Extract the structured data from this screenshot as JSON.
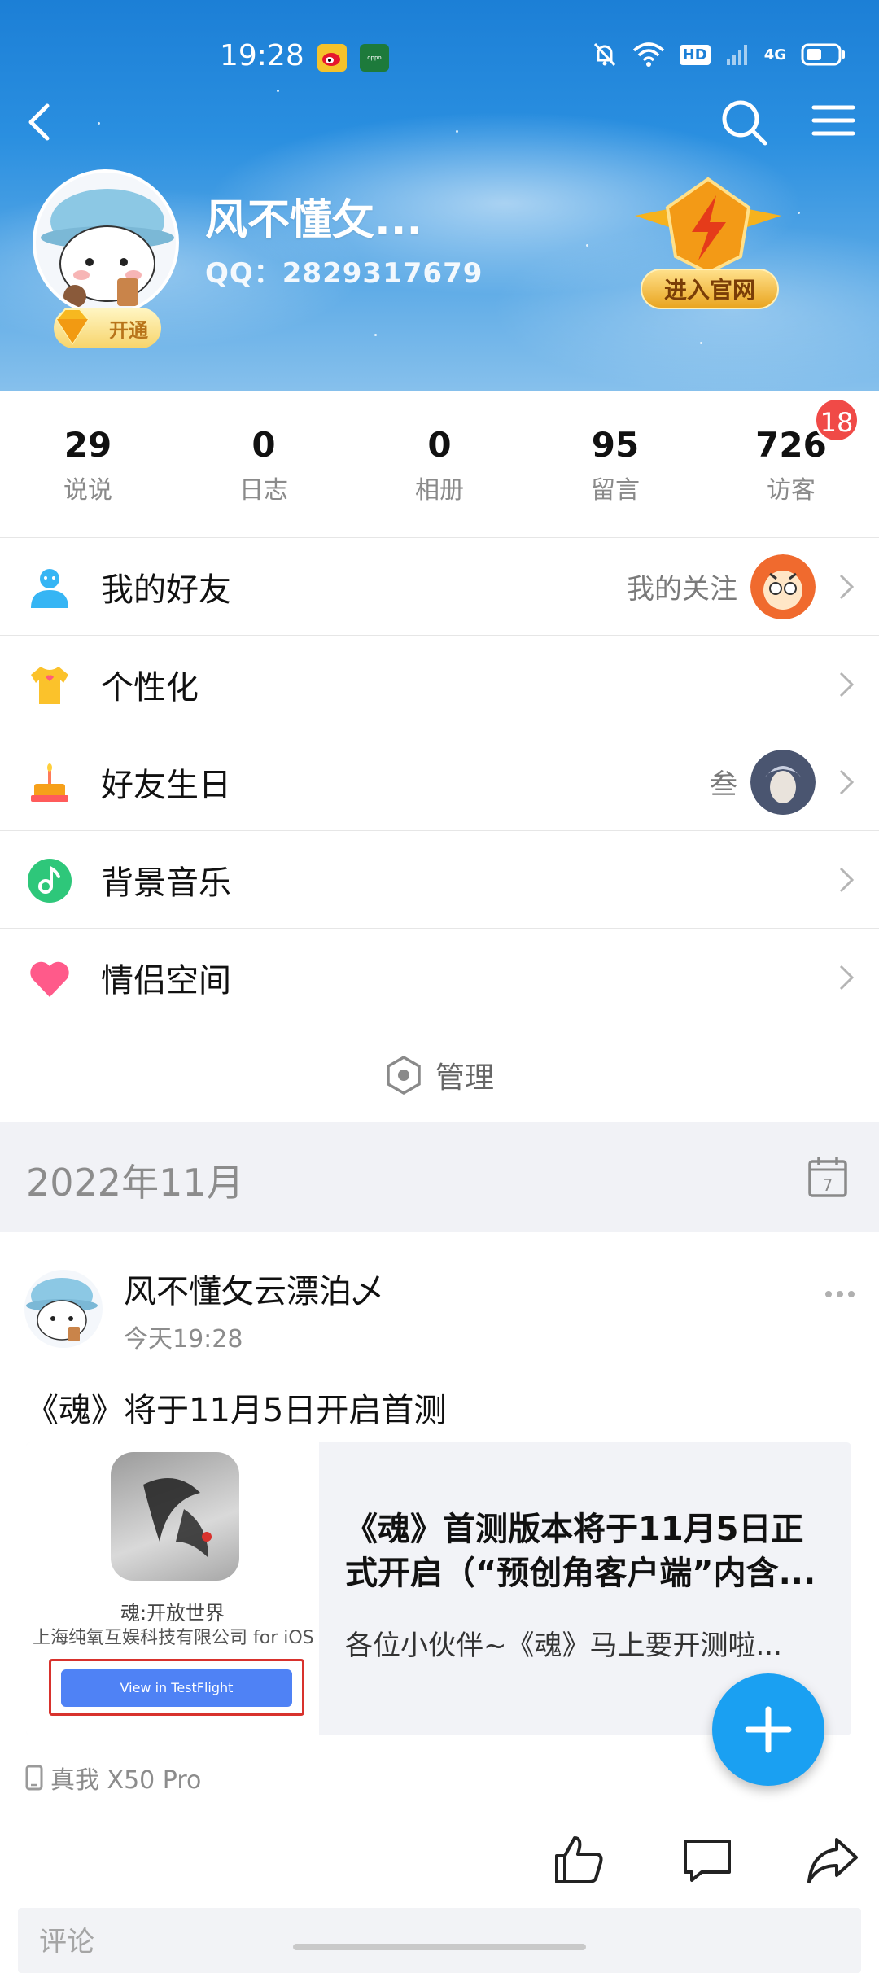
{
  "status_bar": {
    "time": "19:28",
    "network_label": "HD",
    "network_gen": "4G"
  },
  "profile": {
    "nickname": "风不懂攵...",
    "qq_label": "QQ：2829317679",
    "vip_label": "开通",
    "official_site_label": "进入官网"
  },
  "stats": [
    {
      "value": "29",
      "label": "说说"
    },
    {
      "value": "0",
      "label": "日志"
    },
    {
      "value": "0",
      "label": "相册"
    },
    {
      "value": "95",
      "label": "留言"
    },
    {
      "value": "726",
      "label": "访客",
      "badge": "18"
    }
  ],
  "menu": [
    {
      "icon": "friends-icon",
      "label": "我的好友",
      "right_text": "我的关注"
    },
    {
      "icon": "tshirt-icon",
      "label": "个性化"
    },
    {
      "icon": "birthday-cake-icon",
      "label": "好友生日",
      "right_text": "叁"
    },
    {
      "icon": "music-note-icon",
      "label": "背景音乐"
    },
    {
      "icon": "heart-icon",
      "label": "情侣空间"
    }
  ],
  "manage_label": "管理",
  "timeline": {
    "month": "2022年11月",
    "calendar_day": "7"
  },
  "post": {
    "author": "风不懂攵云漂泊乄",
    "time": "今天19:28",
    "text": "《魂》将于11月5日开启首测",
    "card": {
      "app_name": "魂:开放世界",
      "developer": "上海纯氧互娱科技有限公司 for iOS",
      "button": "View in TestFlight",
      "title": "《魂》首测版本将于11月5日正式开启（“预创角客户端”内含...",
      "desc": "各位小伙伴~《魂》马上要开测啦..."
    },
    "device": "真我 X50 Pro",
    "comment_placeholder": "评论"
  },
  "colors": {
    "accent": "#1aa0f2",
    "badge": "#f04a47",
    "header_blue": "#2a8fe0"
  }
}
